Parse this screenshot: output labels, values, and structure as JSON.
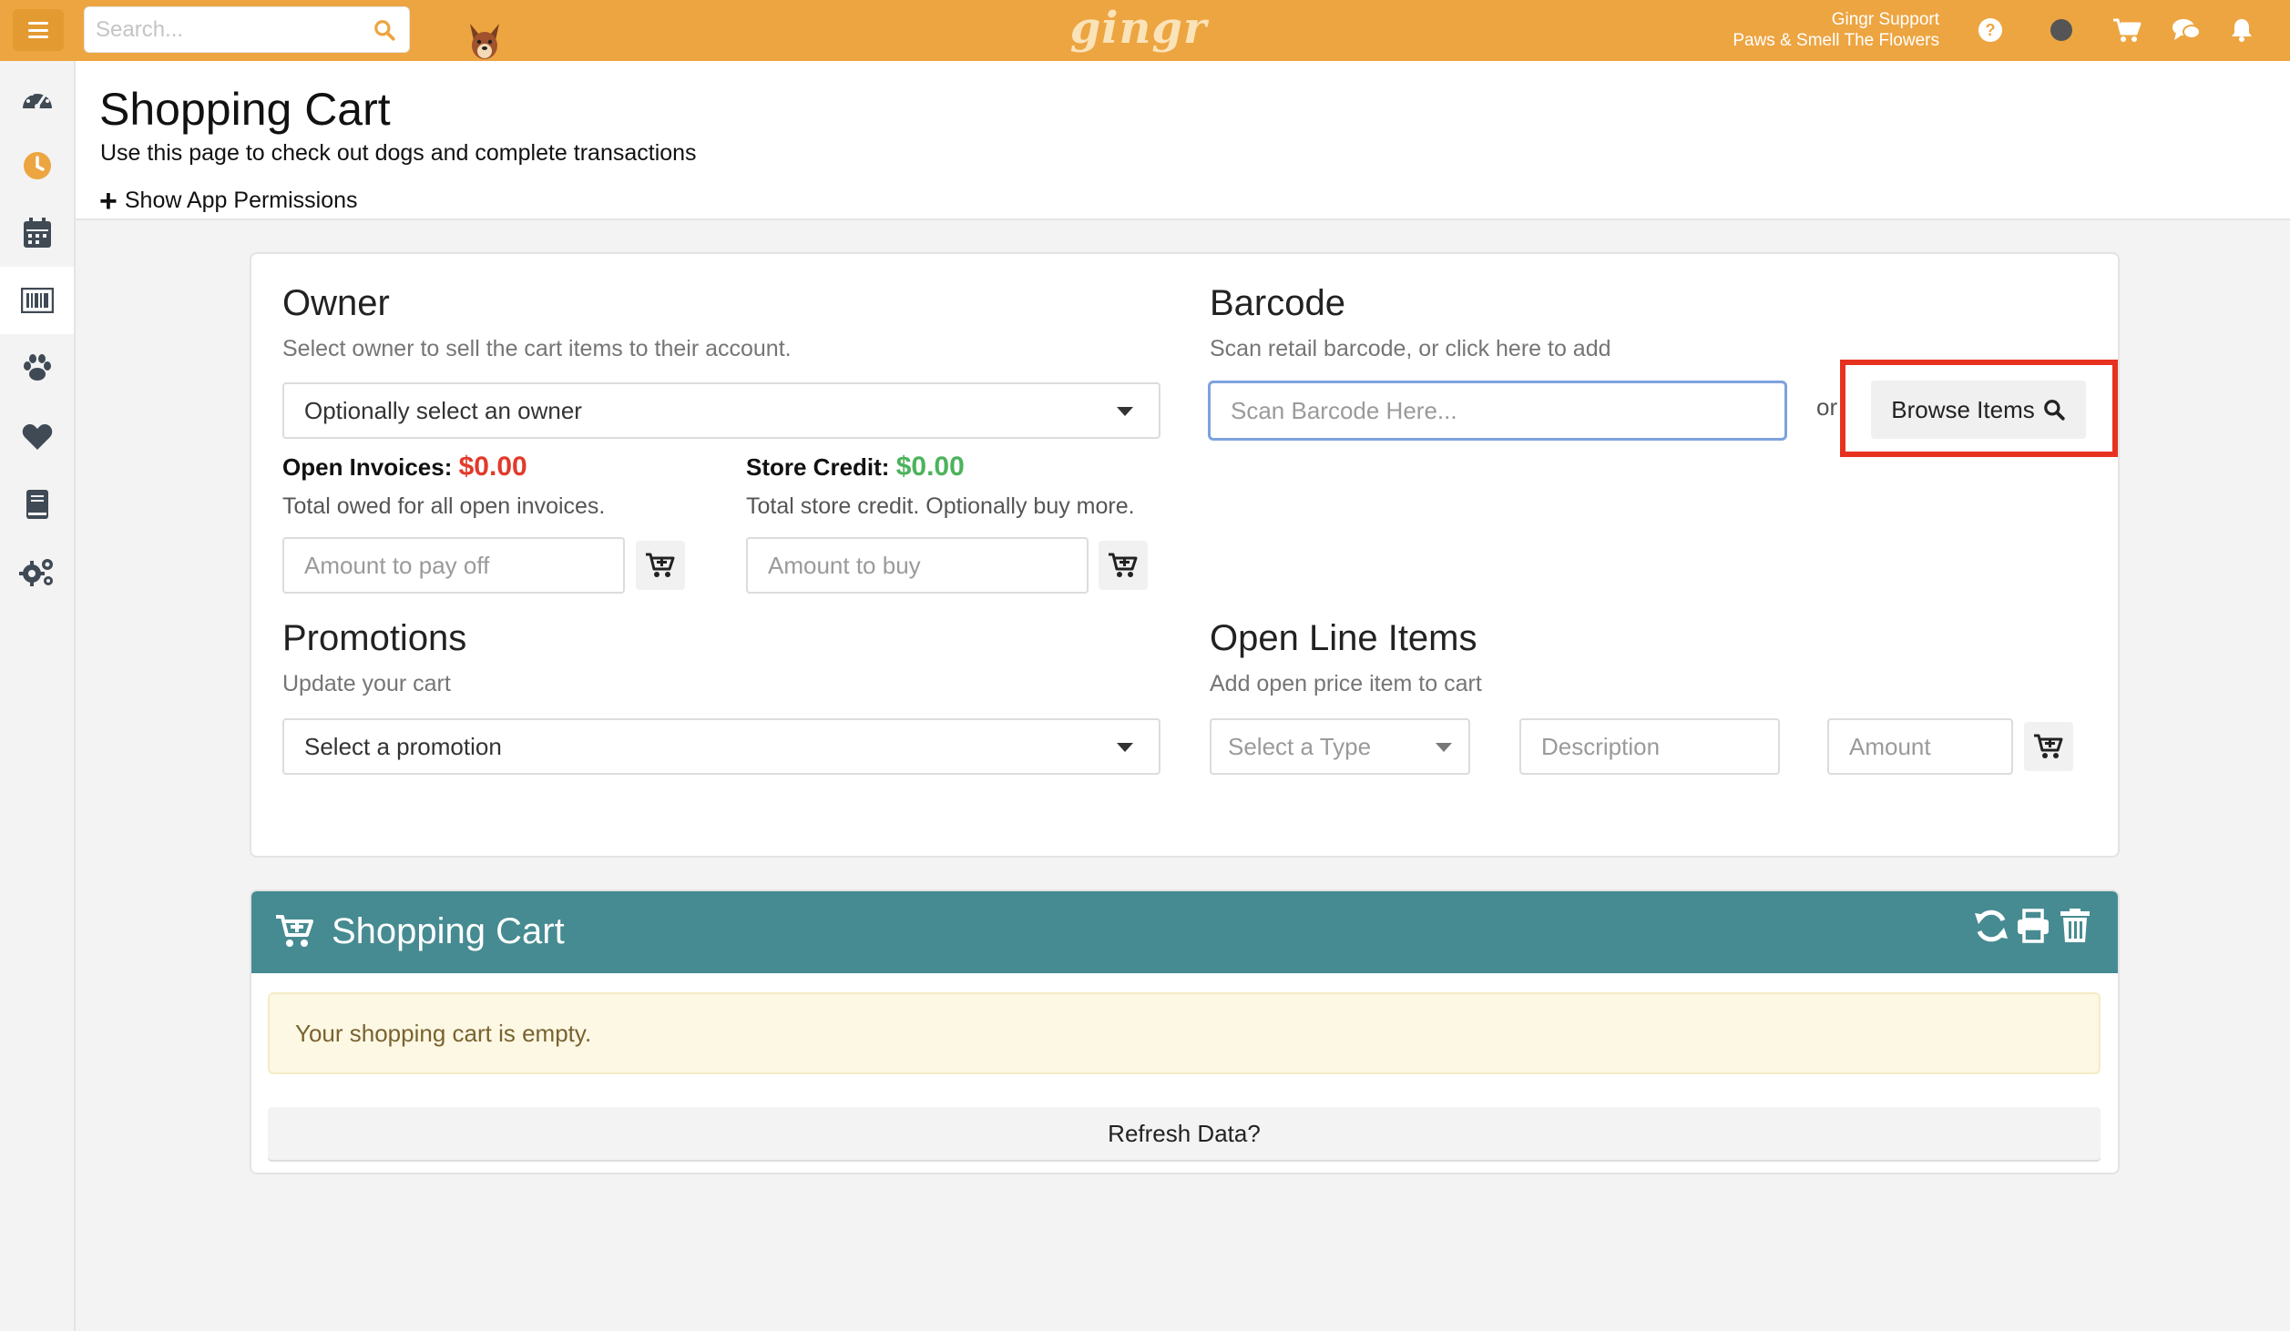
{
  "app": {
    "brand": "gingr",
    "accent_color": "#eda541",
    "teal_color": "#468b91"
  },
  "topbar": {
    "search_placeholder": "Search...",
    "user_name": "Gingr Support",
    "location": "Paws & Smell The Flowers",
    "icons": [
      "help-icon",
      "status-dot-icon",
      "cart-icon",
      "chat-icon",
      "bell-icon"
    ]
  },
  "sidebar": {
    "items": [
      "dashboard-icon",
      "clock-icon",
      "calendar-icon",
      "barcode-icon",
      "paw-icon",
      "heart-icon",
      "book-icon",
      "settings-icon"
    ],
    "active": "barcode-icon"
  },
  "header": {
    "title": "Shopping Cart",
    "subtitle": "Use this page to check out dogs and complete transactions",
    "permissions_link": "Show App Permissions"
  },
  "owner": {
    "title": "Owner",
    "subtitle": "Select owner to sell the cart items to their account.",
    "select_value": "Optionally select an owner",
    "open_invoices_label": "Open Invoices:",
    "open_invoices_amount": "$0.00",
    "open_invoices_desc": "Total owed for all open invoices.",
    "pay_off_placeholder": "Amount to pay off",
    "store_credit_label": "Store Credit:",
    "store_credit_amount": "$0.00",
    "store_credit_desc": "Total store credit. Optionally buy more.",
    "buy_placeholder": "Amount to buy"
  },
  "barcode": {
    "title": "Barcode",
    "subtitle": "Scan retail barcode, or click here to add",
    "placeholder": "Scan Barcode Here...",
    "or_text": "or",
    "browse_label": "Browse Items"
  },
  "promotions": {
    "title": "Promotions",
    "subtitle": "Update your cart",
    "select_value": "Select a promotion"
  },
  "open_line_items": {
    "title": "Open Line Items",
    "subtitle": "Add open price item to cart",
    "type_select": "Select a Type",
    "description_placeholder": "Description",
    "amount_placeholder": "Amount"
  },
  "cart": {
    "title": "Shopping Cart",
    "empty_message": "Your shopping cart is empty.",
    "refresh_label": "Refresh Data?"
  }
}
